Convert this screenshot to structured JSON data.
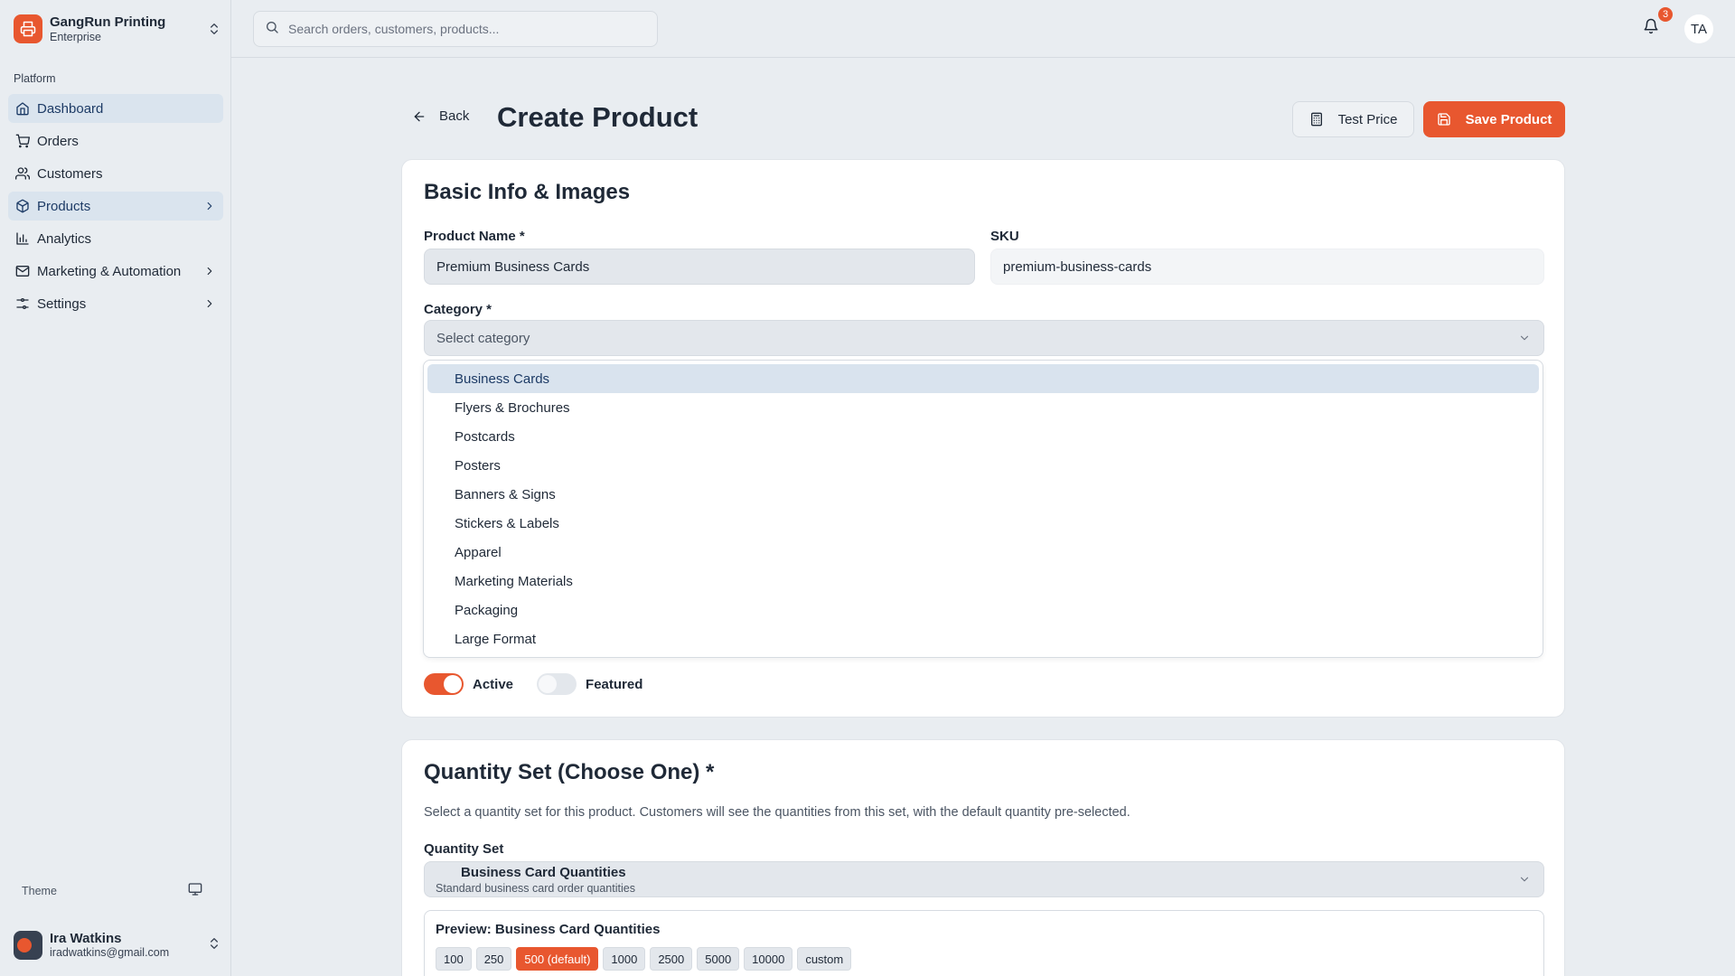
{
  "sidebar": {
    "brand": {
      "name": "GangRun Printing",
      "plan": "Enterprise"
    },
    "section": "Platform",
    "items": [
      {
        "label": "Dashboard",
        "icon": "home-icon",
        "active": true,
        "chevron": false
      },
      {
        "label": "Orders",
        "icon": "cart-icon",
        "active": false,
        "chevron": false
      },
      {
        "label": "Customers",
        "icon": "users-icon",
        "active": false,
        "chevron": false
      },
      {
        "label": "Products",
        "icon": "package-icon",
        "active": true,
        "chevron": true
      },
      {
        "label": "Analytics",
        "icon": "bar-chart-icon",
        "active": false,
        "chevron": false
      },
      {
        "label": "Marketing & Automation",
        "icon": "mail-icon",
        "active": false,
        "chevron": true
      },
      {
        "label": "Settings",
        "icon": "sliders-icon",
        "active": false,
        "chevron": true
      }
    ],
    "theme_label": "Theme",
    "user": {
      "name": "Ira Watkins",
      "email": "iradwatkins@gmail.com"
    }
  },
  "topbar": {
    "search_placeholder": "Search orders, customers, products...",
    "notification_count": "3",
    "avatar_initials": "TA"
  },
  "header": {
    "back_label": "Back",
    "title": "Create Product",
    "test_price_label": "Test Price",
    "save_label": "Save Product"
  },
  "basic_info": {
    "title": "Basic Info & Images",
    "product_name_label": "Product Name *",
    "product_name_value": "Premium Business Cards",
    "sku_label": "SKU",
    "sku_value": "premium-business-cards",
    "category_label": "Category *",
    "category_placeholder": "Select category",
    "category_options": [
      "Business Cards",
      "Flyers & Brochures",
      "Postcards",
      "Posters",
      "Banners & Signs",
      "Stickers & Labels",
      "Apparel",
      "Marketing Materials",
      "Packaging",
      "Large Format"
    ],
    "highlighted_option": "Business Cards",
    "active_label": "Active",
    "active_on": true,
    "featured_label": "Featured",
    "featured_on": false
  },
  "quantity_set": {
    "title": "Quantity Set (Choose One) *",
    "description": "Select a quantity set for this product. Customers will see the quantities from this set, with the default quantity pre-selected.",
    "field_label": "Quantity Set",
    "selected_name": "Business Card Quantities",
    "selected_description": "Standard business card order quantities",
    "preview_title": "Preview: Business Card Quantities",
    "quantities": [
      "100",
      "250",
      "500 (default)",
      "1000",
      "2500",
      "5000",
      "10000",
      "custom"
    ],
    "default_quantity": "500 (default)"
  },
  "colors": {
    "accent": "#e8572f",
    "active_nav_bg": "#dae4ee",
    "page_bg": "#e9edf1"
  }
}
